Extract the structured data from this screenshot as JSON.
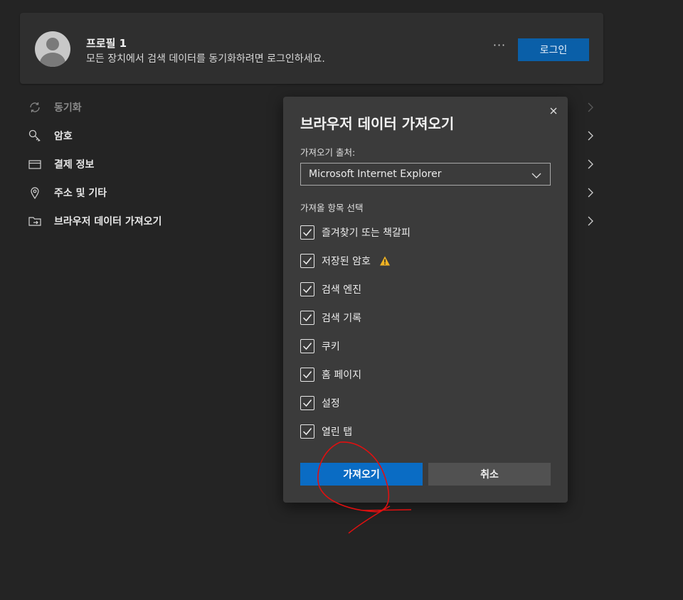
{
  "profile": {
    "name": "프로필 1",
    "description": "모든 장치에서 검색 데이터를 동기화하려면 로그인하세요.",
    "more_label": "···",
    "login_label": "로그인",
    "login_color": "#0a5fa8"
  },
  "settings": {
    "items": [
      {
        "label": "동기화",
        "icon": "sync-icon",
        "disabled": true
      },
      {
        "label": "암호",
        "icon": "key-icon",
        "disabled": false
      },
      {
        "label": "결제 정보",
        "icon": "credit-card-icon",
        "disabled": false
      },
      {
        "label": "주소 및 기타",
        "icon": "location-pin-icon",
        "disabled": false
      },
      {
        "label": "브라우저 데이터 가져오기",
        "icon": "import-folder-icon",
        "disabled": false
      }
    ]
  },
  "dialog": {
    "title": "브라우저 데이터 가져오기",
    "source_label": "가져오기 출처:",
    "source_value": "Microsoft Internet Explorer",
    "items_label": "가져올 항목 선택",
    "checkboxes": [
      {
        "label": "즐겨찾기 또는 책갈피",
        "checked": true
      },
      {
        "label": "저장된 암호",
        "checked": true,
        "warning": true
      },
      {
        "label": "검색 엔진",
        "checked": true
      },
      {
        "label": "검색 기록",
        "checked": true
      },
      {
        "label": "쿠키",
        "checked": true
      },
      {
        "label": "홈 페이지",
        "checked": true
      },
      {
        "label": "설정",
        "checked": true
      },
      {
        "label": "열린 탭",
        "checked": true
      }
    ],
    "import_label": "가져오기",
    "cancel_label": "취소",
    "accent_color": "#0a6cc4",
    "warning_color": "#f0b323"
  },
  "annotation": {
    "color": "#e01010",
    "type": "red hand-drawn circle around import button"
  }
}
